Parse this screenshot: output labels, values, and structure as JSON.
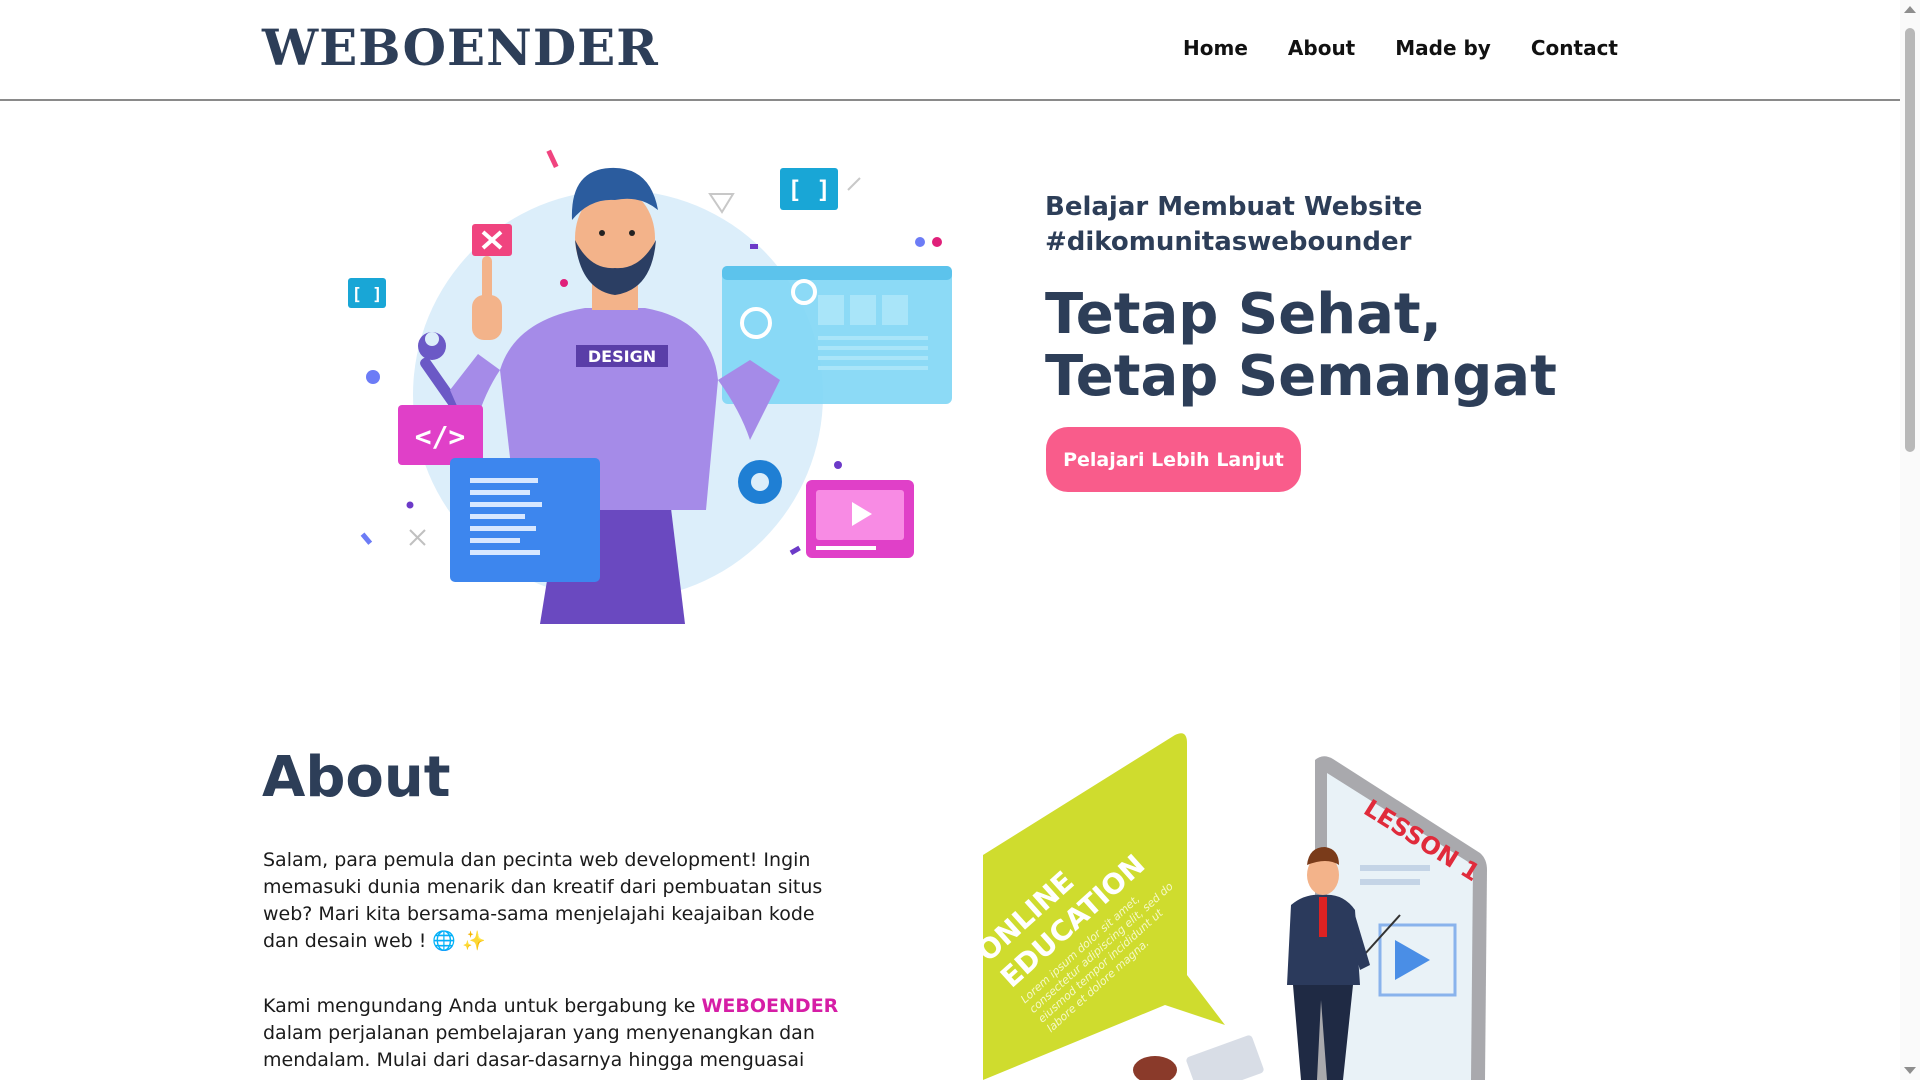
{
  "header": {
    "brand": "WEBOENDER",
    "nav": [
      {
        "label": "Home"
      },
      {
        "label": "About"
      },
      {
        "label": "Made by"
      },
      {
        "label": "Contact"
      }
    ]
  },
  "hero": {
    "subtitle_line1": "Belajar Membuat Website",
    "subtitle_line2": "#dikomunitaswebounder",
    "title": "Tetap Sehat, Tetap Semangat",
    "cta_label": "Pelajari Lebih Lanjut",
    "illustration": {
      "shirt_text": "DESIGN",
      "code_badge": "</>",
      "bracket_badge": "[ ]",
      "small_bracket_badge": "[ ]"
    }
  },
  "about": {
    "title": "About",
    "paragraph1": "Salam, para pemula dan pecinta web development! Ingin memasuki dunia menarik dan kreatif dari pembuatan situs web? Mari kita bersama-sama menjelajahi keajaiban kode dan desain web ! 🌐 ✨",
    "paragraph2_before": "Kami mengundang Anda untuk bergabung ke ",
    "paragraph2_brand": "WEBOENDER",
    "paragraph2_after": " dalam perjalanan pembelajaran yang menyenangkan dan mendalam. Mulai dari dasar-dasarnya hingga menguasai",
    "illustration": {
      "bubble_line1": "ONLINE",
      "bubble_line2": "EDUCATION",
      "bubble_lorem": "Lorem ipsum dolor sit amet, consectetur adipiscing elit, sed do eiusmod tempor incididunt ut labore et dolore magna.",
      "board_text": "LESSON 1"
    }
  },
  "colors": {
    "brand_navy": "#2d3e58",
    "cta_pink": "#f95c8b",
    "brand_magenta": "#d61ea6"
  }
}
